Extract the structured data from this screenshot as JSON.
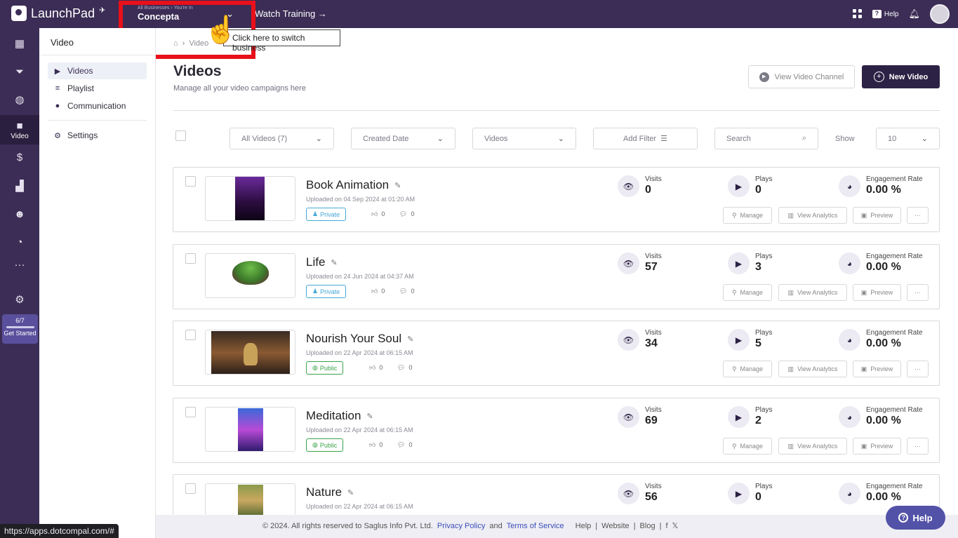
{
  "topbar": {
    "app_name": "LaunchPad",
    "business_crumb": "All Businesses › You're In",
    "business_name": "Concepta",
    "watch_training": "Watch Training →",
    "help_label": "Help",
    "icons": [
      "apps-grid-icon",
      "help-icon",
      "bell-icon",
      "avatar"
    ]
  },
  "tooltip": {
    "text": "Click here to switch business"
  },
  "rail": {
    "items": [
      {
        "icon": "dashboard-icon"
      },
      {
        "icon": "funnel-icon"
      },
      {
        "icon": "globe-icon"
      },
      {
        "icon": "video-camera-icon",
        "label": "Video"
      },
      {
        "icon": "dollar-icon"
      },
      {
        "icon": "analytics-icon"
      },
      {
        "icon": "users-icon"
      },
      {
        "icon": "gauge-icon"
      },
      {
        "icon": "more-icon"
      },
      {
        "icon": "gear-icon"
      }
    ],
    "get_started": {
      "progress": "6/7",
      "label": "Get Started"
    }
  },
  "subnav": {
    "title": "Video",
    "items": [
      {
        "label": "Videos",
        "icon": "play-square-icon"
      },
      {
        "label": "Playlist",
        "icon": "playlist-icon"
      },
      {
        "label": "Communication",
        "icon": "chat-icon"
      },
      {
        "label": "Settings",
        "icon": "gear-icon"
      }
    ]
  },
  "breadcrumb": {
    "current": "Video"
  },
  "main": {
    "title": "Videos",
    "subtitle": "Manage all your video campaigns here",
    "view_channel": "View Video Channel",
    "new_video": "New Video"
  },
  "filters": {
    "all_videos": "All Videos (7)",
    "created_date": "Created Date",
    "videos": "Videos",
    "add_filter": "Add Filter",
    "search_placeholder": "Search",
    "show_label": "Show",
    "show_value": "10"
  },
  "labels": {
    "visits": "Visits",
    "plays": "Plays",
    "engagement": "Engagement Rate",
    "manage": "Manage",
    "view_analytics": "View Analytics",
    "preview": "Preview",
    "more": "···"
  },
  "videos": [
    {
      "title": "Book Animation",
      "date": "Uploaded on 04 Sep 2024 at 01:20 AM",
      "privacy": "Private",
      "likes": "0",
      "comments": "0",
      "visits": "0",
      "plays": "0",
      "engagement": "0.00 %"
    },
    {
      "title": "Life",
      "date": "Uploaded on 24 Jun 2024 at 04:37 AM",
      "privacy": "Private",
      "likes": "0",
      "comments": "0",
      "visits": "57",
      "plays": "3",
      "engagement": "0.00 %"
    },
    {
      "title": "Nourish Your Soul",
      "date": "Uploaded on 22 Apr 2024 at 06:15 AM",
      "privacy": "Public",
      "likes": "0",
      "comments": "0",
      "visits": "34",
      "plays": "5",
      "engagement": "0.00 %"
    },
    {
      "title": "Meditation",
      "date": "Uploaded on 22 Apr 2024 at 06:15 AM",
      "privacy": "Public",
      "likes": "0",
      "comments": "0",
      "visits": "69",
      "plays": "2",
      "engagement": "0.00 %"
    },
    {
      "title": "Nature",
      "date": "Uploaded on 22 Apr 2024 at 06:15 AM",
      "privacy": "",
      "likes": "",
      "comments": "",
      "visits": "56",
      "plays": "0",
      "engagement": "0.00 %"
    }
  ],
  "footer": {
    "copyright": "© 2024. All rights reserved to Saglus Info Pvt. Ltd.",
    "privacy": "Privacy Policy",
    "and": "and",
    "terms": "Terms of Service",
    "help": "Help",
    "website": "Website",
    "blog": "Blog",
    "sep": "|"
  },
  "help_fab": "Help",
  "status_url": "https://apps.dotcompal.com/#"
}
